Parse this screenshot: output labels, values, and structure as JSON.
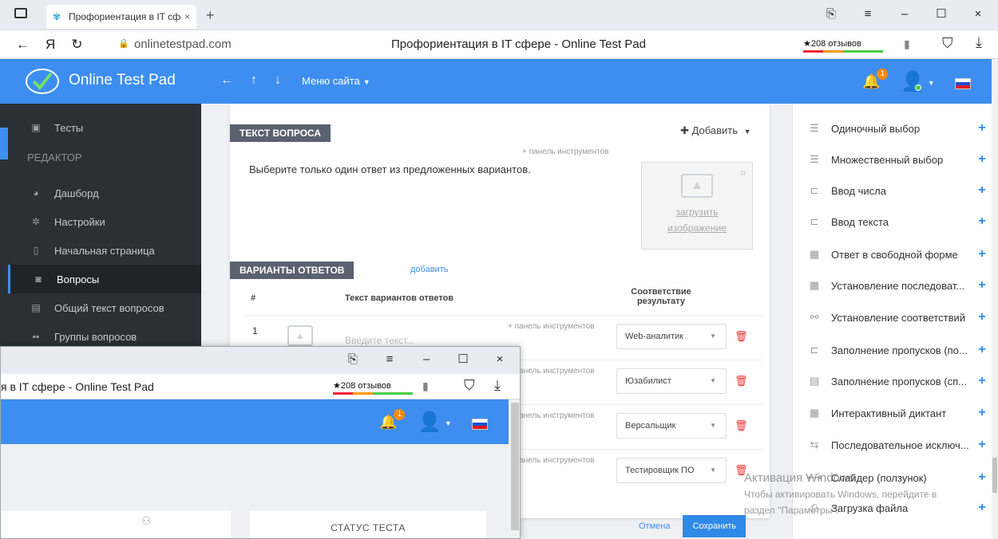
{
  "browser": {
    "tab_title": "Профориентация в IT сфере",
    "tab_close": "×",
    "new_tab": "+",
    "host": "onlinetestpad.com",
    "page_title": "Профориентация в IT сфере - Online Test Pad",
    "reviews": "★208 отзывов"
  },
  "site": {
    "brand": "Online Test Pad",
    "nav_back": "←",
    "nav_up": "↑",
    "nav_down": "↓",
    "menu": "Меню сайта",
    "notif_count": "1"
  },
  "sidebar": {
    "items": [
      {
        "label": "Тесты",
        "icon": "book-icon"
      },
      {
        "label": "Дашборд",
        "icon": "dashboard-icon"
      },
      {
        "label": "Настройки",
        "icon": "gear-icon"
      },
      {
        "label": "Начальная страница",
        "icon": "file-icon"
      },
      {
        "label": "Вопросы",
        "icon": "question-icon"
      },
      {
        "label": "Общий текст вопросов",
        "icon": "list-icon"
      },
      {
        "label": "Группы вопросов",
        "icon": "groups-icon"
      }
    ],
    "section_header": "РЕДАКТОР"
  },
  "editor": {
    "question_section": "ТЕКСТ ВОПРОСА",
    "add_label": "Добавить",
    "toolbar_hint": "+ панель инструментов",
    "question_text": "Выберите только один ответ из предложенных вариантов.",
    "upload_line1": "загрузить",
    "upload_line2": "изображение",
    "answers_section": "ВАРИАНТЫ ОТВЕТОВ",
    "answers_add": "добавить",
    "col_num": "#",
    "col_text": "Текст вариантов ответов",
    "col_match": "Соответствие результату",
    "input_placeholder": "Введите текст...",
    "answers": [
      {
        "num": "1",
        "result": "Web-аналитик"
      },
      {
        "num": "",
        "result": "Юзабилист"
      },
      {
        "num": "",
        "result": "Версальщик"
      },
      {
        "num": "",
        "result": "Тестировщик ПО"
      }
    ],
    "cancel": "Отмена",
    "save": "Сохранить"
  },
  "right_panel": {
    "items": [
      {
        "label": "Одиночный выбор",
        "icon": "single-choice-icon"
      },
      {
        "label": "Множественный выбор",
        "icon": "multi-choice-icon"
      },
      {
        "label": "Ввод числа",
        "icon": "number-input-icon"
      },
      {
        "label": "Ввод текста",
        "icon": "text-input-icon"
      },
      {
        "label": "Ответ в свободной форме",
        "icon": "free-form-icon"
      },
      {
        "label": "Установление последоват...",
        "icon": "sequence-icon"
      },
      {
        "label": "Установление соответствий",
        "icon": "link-icon"
      },
      {
        "label": "Заполнение пропусков (по...",
        "icon": "gap-fill-icon"
      },
      {
        "label": "Заполнение пропусков (сп...",
        "icon": "gap-list-icon"
      },
      {
        "label": "Интерактивный диктант",
        "icon": "dictation-icon"
      },
      {
        "label": "Последовательное исключ...",
        "icon": "exclusion-icon"
      },
      {
        "label": "Слайдер (ползунок)",
        "icon": "slider-icon"
      },
      {
        "label": "Загрузка файла",
        "icon": "upload-icon"
      }
    ]
  },
  "watermark": {
    "line1": "Активация Windows",
    "line2": "Чтобы активировать Windows, перейдите в",
    "line3": "раздел \"Параметры\"."
  },
  "overlay": {
    "page_title": "я в IT сфере - Online Test Pad",
    "reviews": "★208 отзывов",
    "status": "СТАТУС ТЕСТА"
  }
}
